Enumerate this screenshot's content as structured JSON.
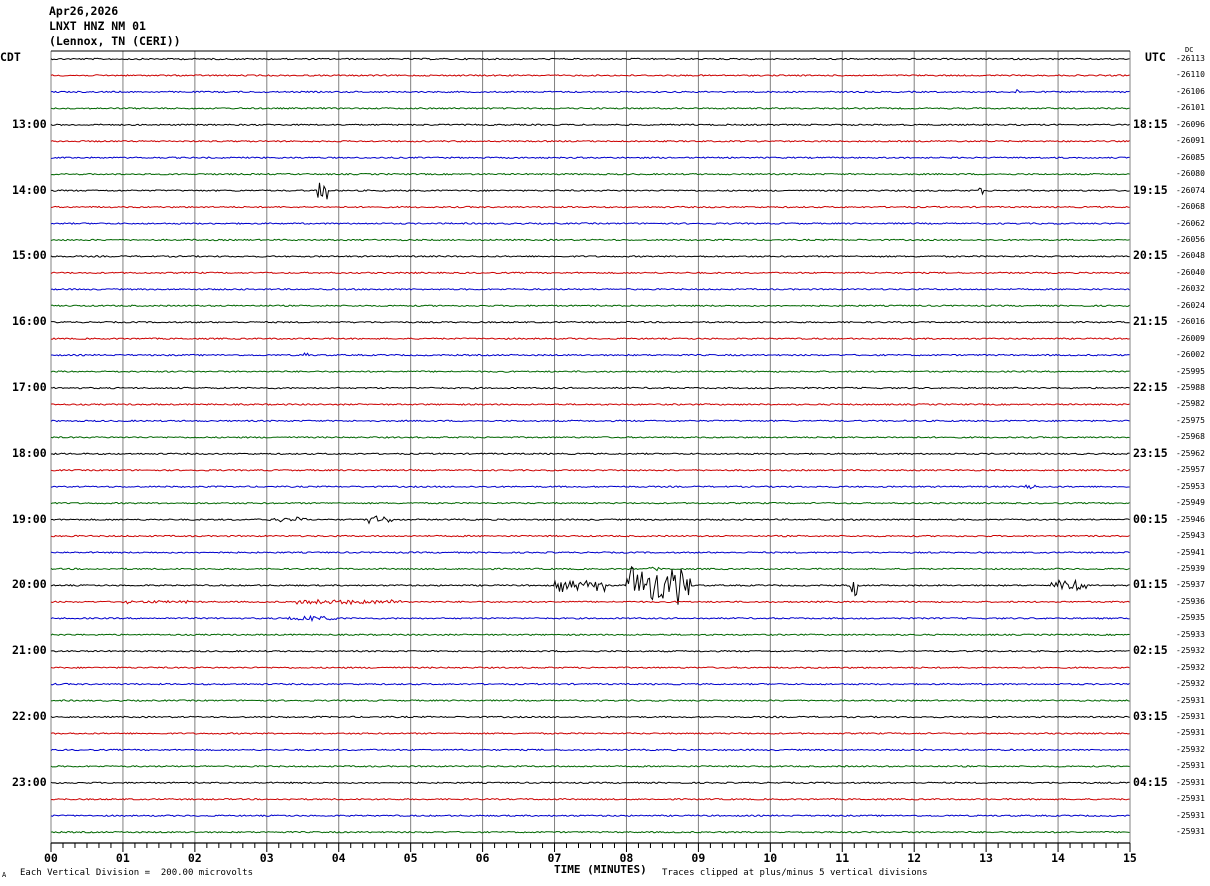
{
  "header": {
    "date": "Apr26,2026",
    "station": "LNXT HNZ NM 01",
    "location": "(Lennox, TN (CERI))"
  },
  "left_tz": "CDT",
  "right_tz": "UTC",
  "dc_label": "DC",
  "xlabel": "TIME (MINUTES)",
  "footer": {
    "scale": "Each Vertical Division =  200.00 microvolts",
    "clip": "Traces clipped at plus/minus 5 vertical divisions",
    "corner_mark": "A"
  },
  "colors": {
    "trace_cycle": [
      "#000000",
      "#cc0000",
      "#0000cc",
      "#006600"
    ],
    "grid": "#808080"
  },
  "chart_data": {
    "type": "line",
    "x": {
      "min": 0,
      "max": 15,
      "ticks": [
        "00",
        "01",
        "02",
        "03",
        "04",
        "05",
        "06",
        "07",
        "08",
        "09",
        "10",
        "11",
        "12",
        "13",
        "14",
        "15"
      ]
    },
    "left_hour_labels": [
      {
        "trace": 4,
        "label": "13:00"
      },
      {
        "trace": 8,
        "label": "14:00"
      },
      {
        "trace": 12,
        "label": "15:00"
      },
      {
        "trace": 16,
        "label": "16:00"
      },
      {
        "trace": 20,
        "label": "17:00"
      },
      {
        "trace": 24,
        "label": "18:00"
      },
      {
        "trace": 28,
        "label": "19:00"
      },
      {
        "trace": 32,
        "label": "20:00"
      },
      {
        "trace": 36,
        "label": "21:00"
      },
      {
        "trace": 40,
        "label": "22:00"
      },
      {
        "trace": 44,
        "label": "23:00"
      }
    ],
    "right_hour_labels": [
      {
        "trace": 4,
        "label": "18:15"
      },
      {
        "trace": 8,
        "label": "19:15"
      },
      {
        "trace": 12,
        "label": "20:15"
      },
      {
        "trace": 16,
        "label": "21:15"
      },
      {
        "trace": 20,
        "label": "22:15"
      },
      {
        "trace": 24,
        "label": "23:15"
      },
      {
        "trace": 28,
        "label": "00:15"
      },
      {
        "trace": 32,
        "label": "01:15"
      },
      {
        "trace": 36,
        "label": "02:15"
      },
      {
        "trace": 40,
        "label": "03:15"
      },
      {
        "trace": 44,
        "label": "04:15"
      }
    ],
    "dc_offsets": [
      "-26113",
      "-26110",
      "-26106",
      "-26101",
      "-26096",
      "-26091",
      "-26085",
      "-26080",
      "-26074",
      "-26068",
      "-26062",
      "-26056",
      "-26048",
      "-26040",
      "-26032",
      "-26024",
      "-26016",
      "-26009",
      "-26002",
      "-25995",
      "-25988",
      "-25982",
      "-25975",
      "-25968",
      "-25962",
      "-25957",
      "-25953",
      "-25949",
      "-25946",
      "-25943",
      "-25941",
      "-25939",
      "-25937",
      "-25936",
      "-25935",
      "-25933",
      "-25932",
      "-25932",
      "-25932",
      "-25931",
      "-25931",
      "-25931",
      "-25932",
      "-25931",
      "-25931",
      "-25931",
      "-25931",
      "-25931"
    ],
    "events": [
      {
        "trace": 0,
        "start": 0,
        "end": 15,
        "amp": 0.5
      },
      {
        "trace": 2,
        "start": 13.4,
        "end": 13.45,
        "amp": 6
      },
      {
        "trace": 8,
        "start": 3.7,
        "end": 3.85,
        "amp": 14
      },
      {
        "trace": 8,
        "start": 12.9,
        "end": 12.95,
        "amp": 4
      },
      {
        "trace": 18,
        "start": 3.5,
        "end": 3.58,
        "amp": 6
      },
      {
        "trace": 26,
        "start": 13.55,
        "end": 13.7,
        "amp": 3
      },
      {
        "trace": 28,
        "start": 3.0,
        "end": 3.55,
        "amp": 3
      },
      {
        "trace": 28,
        "start": 4.4,
        "end": 4.75,
        "amp": 4
      },
      {
        "trace": 31,
        "start": 8.3,
        "end": 8.45,
        "amp": 2
      },
      {
        "trace": 32,
        "start": 7.0,
        "end": 7.7,
        "amp": 7
      },
      {
        "trace": 32,
        "start": 8.0,
        "end": 8.9,
        "amp": 22
      },
      {
        "trace": 32,
        "start": 11.1,
        "end": 11.2,
        "amp": 12
      },
      {
        "trace": 32,
        "start": 13.9,
        "end": 14.4,
        "amp": 6
      },
      {
        "trace": 33,
        "start": 1.0,
        "end": 1.9,
        "amp": 2
      },
      {
        "trace": 33,
        "start": 3.4,
        "end": 4.9,
        "amp": 3
      },
      {
        "trace": 34,
        "start": 3.2,
        "end": 4.0,
        "amp": 3
      }
    ]
  }
}
